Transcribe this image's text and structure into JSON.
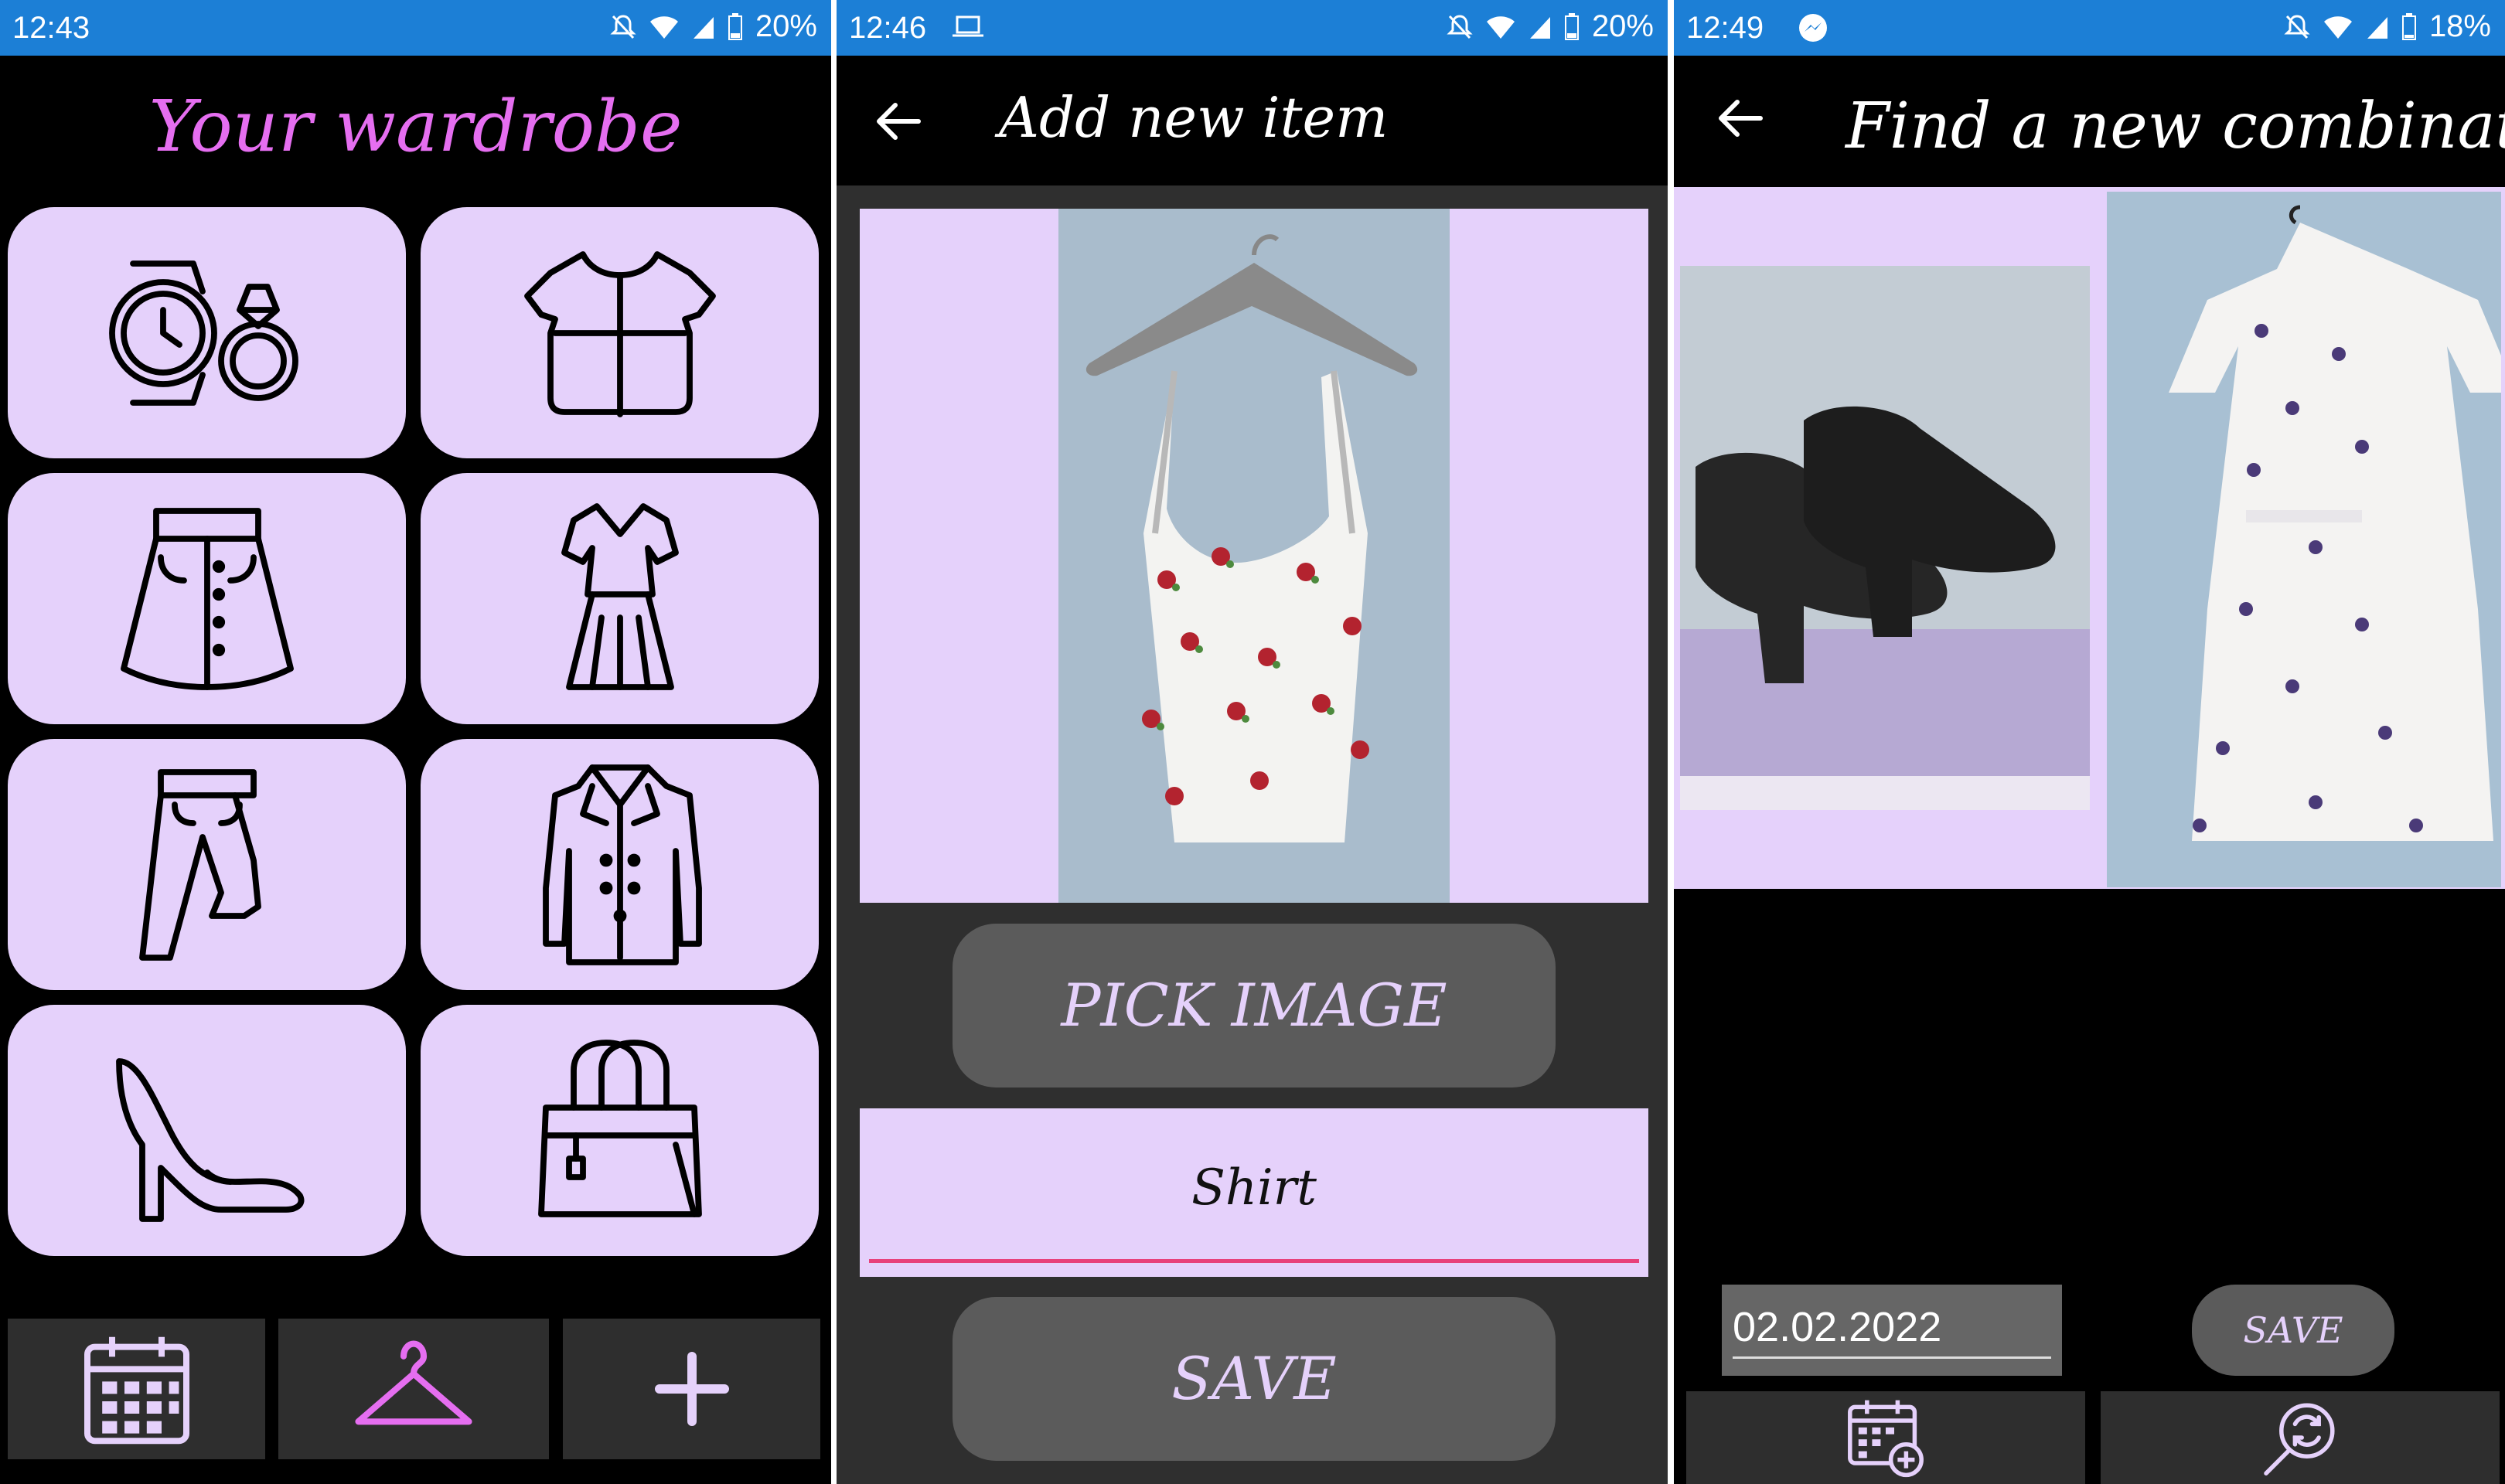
{
  "screen1": {
    "status": {
      "time": "12:43",
      "battery": "20%"
    },
    "title": "Your wardrobe",
    "categories": [
      {
        "icon": "watch-ring-icon"
      },
      {
        "icon": "blouse-icon"
      },
      {
        "icon": "skirt-icon"
      },
      {
        "icon": "dress-icon"
      },
      {
        "icon": "pants-icon"
      },
      {
        "icon": "coat-icon"
      },
      {
        "icon": "high-heel-icon"
      },
      {
        "icon": "handbag-icon"
      }
    ],
    "nav": [
      {
        "icon": "calendar-icon"
      },
      {
        "icon": "hanger-icon"
      },
      {
        "icon": "plus-icon"
      }
    ],
    "colors": {
      "tile": "#e5d1fb",
      "title": "#e56ef0",
      "hanger": "#e56ef0"
    }
  },
  "screen2": {
    "status": {
      "time": "12:46",
      "battery": "20%"
    },
    "title": "Add new item",
    "pick_image_label": "PICK IMAGE",
    "name_value": "Shirt",
    "save_label": "SAVE",
    "colors": {
      "underline": "#e8407a"
    }
  },
  "screen3": {
    "status": {
      "time": "12:49",
      "battery": "18%"
    },
    "title": "Find a new combination",
    "date_value": "02.02.2022",
    "save_label": "SAVE"
  }
}
